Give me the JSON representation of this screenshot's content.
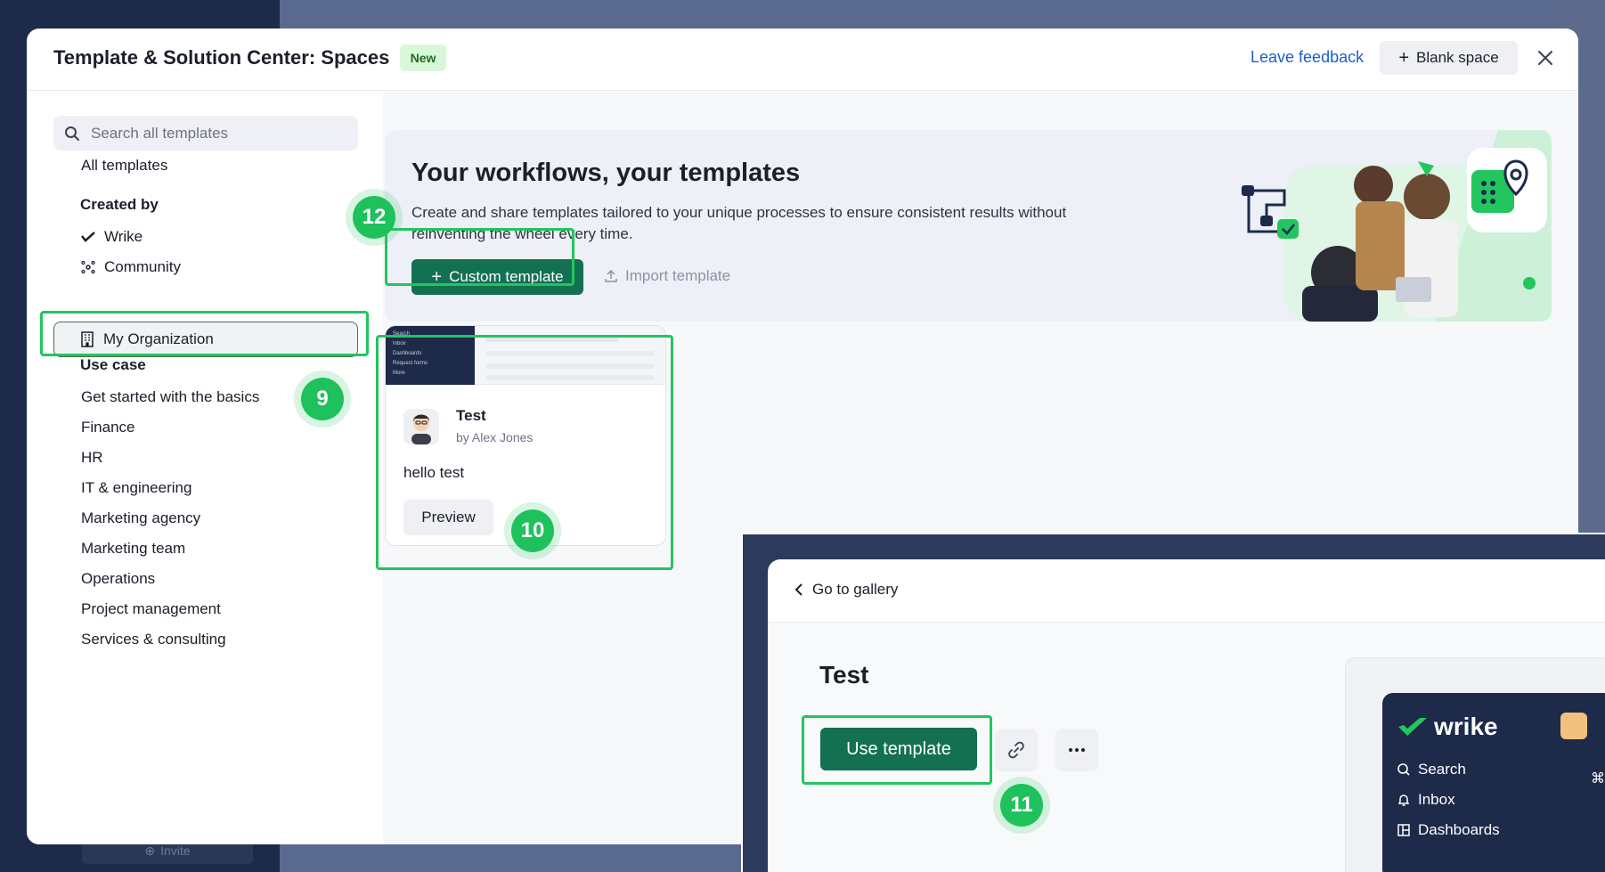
{
  "modal": {
    "title": "Template & Solution Center: Spaces",
    "badge": "New",
    "leave_feedback": "Leave feedback",
    "blank_space": "Blank space"
  },
  "search": {
    "placeholder": "Search all templates"
  },
  "sidebar": {
    "all_templates": "All templates",
    "created_by_heading": "Created by",
    "created_by": [
      {
        "label": "Wrike",
        "icon": "wrike-check-icon"
      },
      {
        "label": "Community",
        "icon": "community-icon"
      },
      {
        "label": "My Organization",
        "icon": "building-icon",
        "selected": true
      }
    ],
    "use_case_heading": "Use case",
    "use_cases": [
      "Get started with the basics",
      "Finance",
      "HR",
      "IT & engineering",
      "Marketing agency",
      "Marketing team",
      "Operations",
      "Project management",
      "Services & consulting"
    ]
  },
  "banner": {
    "title": "Your workflows, your templates",
    "description": "Create and share templates tailored to your unique processes to ensure consistent results without reinventing the wheel every time.",
    "custom_template": "Custom template",
    "import_template": "Import template"
  },
  "card": {
    "title": "Test",
    "author": "by Alex Jones",
    "description": "hello test",
    "preview": "Preview",
    "thumb_nav": [
      "Search",
      "Inbox",
      "Dashboards",
      "Request forms",
      "More"
    ]
  },
  "callouts": [
    "12",
    "9",
    "10",
    "11"
  ],
  "detail": {
    "back": "Go to gallery",
    "title": "Test",
    "use_template": "Use template",
    "link_icon": "link-icon",
    "more_icon": "more-icon"
  },
  "wrike_preview": {
    "logo": "wrike",
    "nav": [
      {
        "label": "Search",
        "shortcut": "⌘"
      },
      {
        "label": "Inbox"
      },
      {
        "label": "Dashboards"
      }
    ]
  },
  "background": {
    "invite": "Invite"
  },
  "colors": {
    "accent": "#137050",
    "highlight": "#22c55e",
    "link": "#1d5ec9",
    "badge_bg": "#d9f8d9"
  }
}
